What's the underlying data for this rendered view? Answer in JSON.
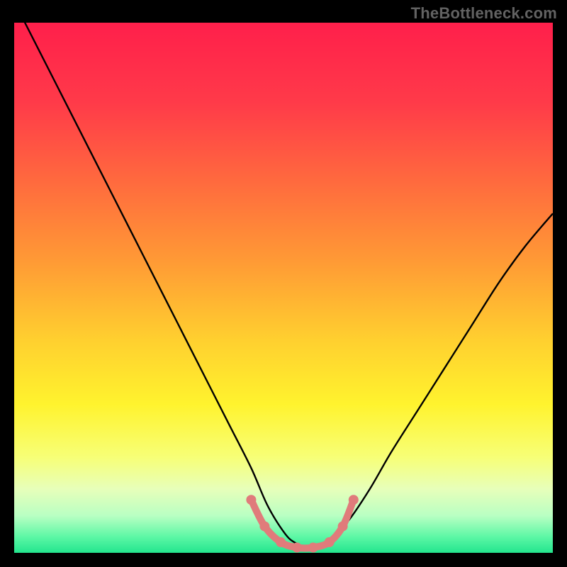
{
  "watermark": "TheBottleneck.com",
  "chart_data": {
    "type": "line",
    "title": "",
    "xlabel": "",
    "ylabel": "",
    "xlim": [
      0,
      100
    ],
    "ylim": [
      0,
      100
    ],
    "grid": false,
    "legend": false,
    "background": {
      "type": "vertical-gradient",
      "stops": [
        {
          "pos": 0.0,
          "color": "#ff1f4b"
        },
        {
          "pos": 0.15,
          "color": "#ff3a49"
        },
        {
          "pos": 0.3,
          "color": "#ff6a3e"
        },
        {
          "pos": 0.45,
          "color": "#ff9a35"
        },
        {
          "pos": 0.6,
          "color": "#ffd02f"
        },
        {
          "pos": 0.72,
          "color": "#fff32e"
        },
        {
          "pos": 0.82,
          "color": "#f7ff77"
        },
        {
          "pos": 0.88,
          "color": "#e7ffba"
        },
        {
          "pos": 0.93,
          "color": "#b9ffc3"
        },
        {
          "pos": 0.97,
          "color": "#5cf7a5"
        },
        {
          "pos": 1.0,
          "color": "#23e58e"
        }
      ]
    },
    "series": [
      {
        "name": "bottleneck-curve",
        "color": "#000000",
        "x": [
          0,
          4,
          8,
          12,
          16,
          20,
          24,
          28,
          32,
          36,
          40,
          44,
          47,
          50,
          52,
          55,
          58,
          62,
          66,
          70,
          75,
          80,
          85,
          90,
          95,
          100
        ],
        "y": [
          104,
          96,
          88,
          80,
          72,
          64,
          56,
          48,
          40,
          32,
          24,
          16,
          9,
          4,
          2,
          1,
          2,
          6,
          12,
          19,
          27,
          35,
          43,
          51,
          58,
          64
        ]
      }
    ],
    "markers": {
      "name": "highlight-dots",
      "color": "#e07b7b",
      "points": [
        {
          "x": 44.0,
          "y": 10.0
        },
        {
          "x": 46.5,
          "y": 5.0
        },
        {
          "x": 49.5,
          "y": 2.0
        },
        {
          "x": 52.5,
          "y": 1.0
        },
        {
          "x": 55.5,
          "y": 1.0
        },
        {
          "x": 58.5,
          "y": 2.0
        },
        {
          "x": 61.0,
          "y": 5.0
        },
        {
          "x": 63.0,
          "y": 10.0
        }
      ]
    }
  }
}
